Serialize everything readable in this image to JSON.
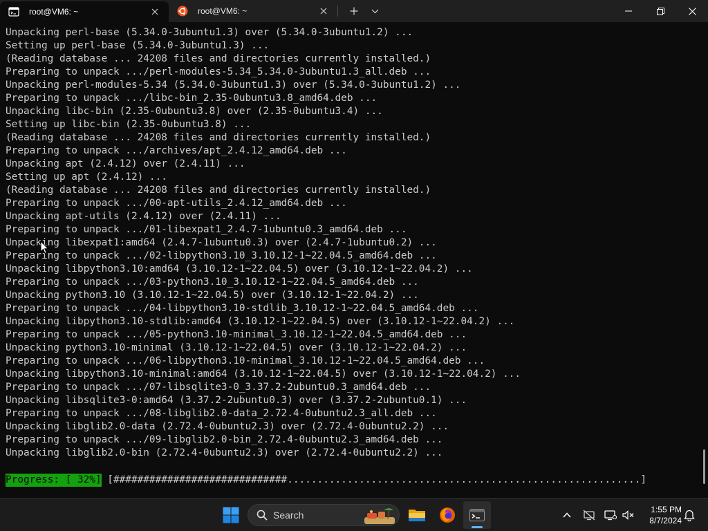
{
  "tabs": [
    {
      "title": "root@VM6: ~",
      "icon": "terminal-icon",
      "active": true
    },
    {
      "title": "root@VM6: ~",
      "icon": "ubuntu-icon",
      "active": false
    }
  ],
  "terminal": {
    "lines": [
      "Unpacking perl-base (5.34.0-3ubuntu1.3) over (5.34.0-3ubuntu1.2) ...",
      "Setting up perl-base (5.34.0-3ubuntu1.3) ...",
      "(Reading database ... 24208 files and directories currently installed.)",
      "Preparing to unpack .../perl-modules-5.34_5.34.0-3ubuntu1.3_all.deb ...",
      "Unpacking perl-modules-5.34 (5.34.0-3ubuntu1.3) over (5.34.0-3ubuntu1.2) ...",
      "Preparing to unpack .../libc-bin_2.35-0ubuntu3.8_amd64.deb ...",
      "Unpacking libc-bin (2.35-0ubuntu3.8) over (2.35-0ubuntu3.4) ...",
      "Setting up libc-bin (2.35-0ubuntu3.8) ...",
      "(Reading database ... 24208 files and directories currently installed.)",
      "Preparing to unpack .../archives/apt_2.4.12_amd64.deb ...",
      "Unpacking apt (2.4.12) over (2.4.11) ...",
      "Setting up apt (2.4.12) ...",
      "(Reading database ... 24208 files and directories currently installed.)",
      "Preparing to unpack .../00-apt-utils_2.4.12_amd64.deb ...",
      "Unpacking apt-utils (2.4.12) over (2.4.11) ...",
      "Preparing to unpack .../01-libexpat1_2.4.7-1ubuntu0.3_amd64.deb ...",
      "Unpacking libexpat1:amd64 (2.4.7-1ubuntu0.3) over (2.4.7-1ubuntu0.2) ...",
      "Preparing to unpack .../02-libpython3.10_3.10.12-1~22.04.5_amd64.deb ...",
      "Unpacking libpython3.10:amd64 (3.10.12-1~22.04.5) over (3.10.12-1~22.04.2) ...",
      "Preparing to unpack .../03-python3.10_3.10.12-1~22.04.5_amd64.deb ...",
      "Unpacking python3.10 (3.10.12-1~22.04.5) over (3.10.12-1~22.04.2) ...",
      "Preparing to unpack .../04-libpython3.10-stdlib_3.10.12-1~22.04.5_amd64.deb ...",
      "Unpacking libpython3.10-stdlib:amd64 (3.10.12-1~22.04.5) over (3.10.12-1~22.04.2) ...",
      "Preparing to unpack .../05-python3.10-minimal_3.10.12-1~22.04.5_amd64.deb ...",
      "Unpacking python3.10-minimal (3.10.12-1~22.04.5) over (3.10.12-1~22.04.2) ...",
      "Preparing to unpack .../06-libpython3.10-minimal_3.10.12-1~22.04.5_amd64.deb ...",
      "Unpacking libpython3.10-minimal:amd64 (3.10.12-1~22.04.5) over (3.10.12-1~22.04.2) ...",
      "Preparing to unpack .../07-libsqlite3-0_3.37.2-2ubuntu0.3_amd64.deb ...",
      "Unpacking libsqlite3-0:amd64 (3.37.2-2ubuntu0.3) over (3.37.2-2ubuntu0.1) ...",
      "Preparing to unpack .../08-libglib2.0-data_2.72.4-0ubuntu2.3_all.deb ...",
      "Unpacking libglib2.0-data (2.72.4-0ubuntu2.3) over (2.72.4-0ubuntu2.2) ...",
      "Preparing to unpack .../09-libglib2.0-bin_2.72.4-0ubuntu2.3_amd64.deb ...",
      "Unpacking libglib2.0-bin (2.72.4-0ubuntu2.3) over (2.72.4-0ubuntu2.2) ..."
    ],
    "progress": {
      "label": "Progress: [ 32%]",
      "percent": 32,
      "bar": " [#############################...........................................................]"
    }
  },
  "taskbar": {
    "search_label": "Search",
    "pinned": [
      "start-icon",
      "file-explorer-icon",
      "firefox-icon",
      "terminal-icon"
    ],
    "tray": [
      "chevron-up-icon",
      "network-off-icon",
      "display-icon",
      "volume-muted-icon",
      "notification-bell-icon"
    ],
    "time": "1:55 PM",
    "date": "8/7/2024"
  },
  "colors": {
    "terminal_bg": "#0c0c0c",
    "terminal_fg": "#cccccc",
    "progress_bg": "#13a10e",
    "titlebar_bg": "#202020",
    "taskbar_bg": "#1c1c1c",
    "accent": "#5cb8f5"
  }
}
